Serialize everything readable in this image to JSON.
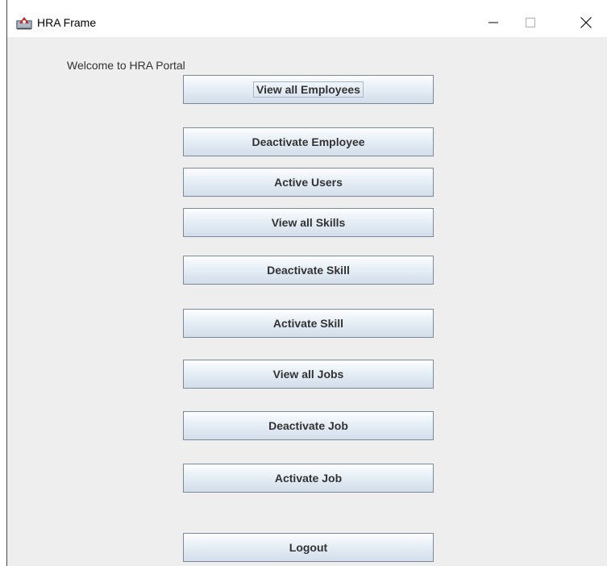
{
  "window": {
    "title": "HRA Frame",
    "icon": "java-cup-icon"
  },
  "content": {
    "welcome_text": "Welcome to HRA Portal"
  },
  "buttons": [
    {
      "label": "View all Employees",
      "focused": true
    },
    {
      "label": "Deactivate Employee",
      "focused": false
    },
    {
      "label": "Active Users",
      "focused": false
    },
    {
      "label": "View all Skills",
      "focused": false
    },
    {
      "label": "Deactivate Skill",
      "focused": false
    },
    {
      "label": "Activate Skill",
      "focused": false
    },
    {
      "label": "View all Jobs",
      "focused": false
    },
    {
      "label": "Deactivate Job",
      "focused": false
    },
    {
      "label": "Activate Job",
      "focused": false
    },
    {
      "label": "Logout",
      "focused": false
    }
  ],
  "colors": {
    "content_background": "#eeeeee",
    "button_border": "#7a8a99",
    "button_text": "#333333"
  }
}
